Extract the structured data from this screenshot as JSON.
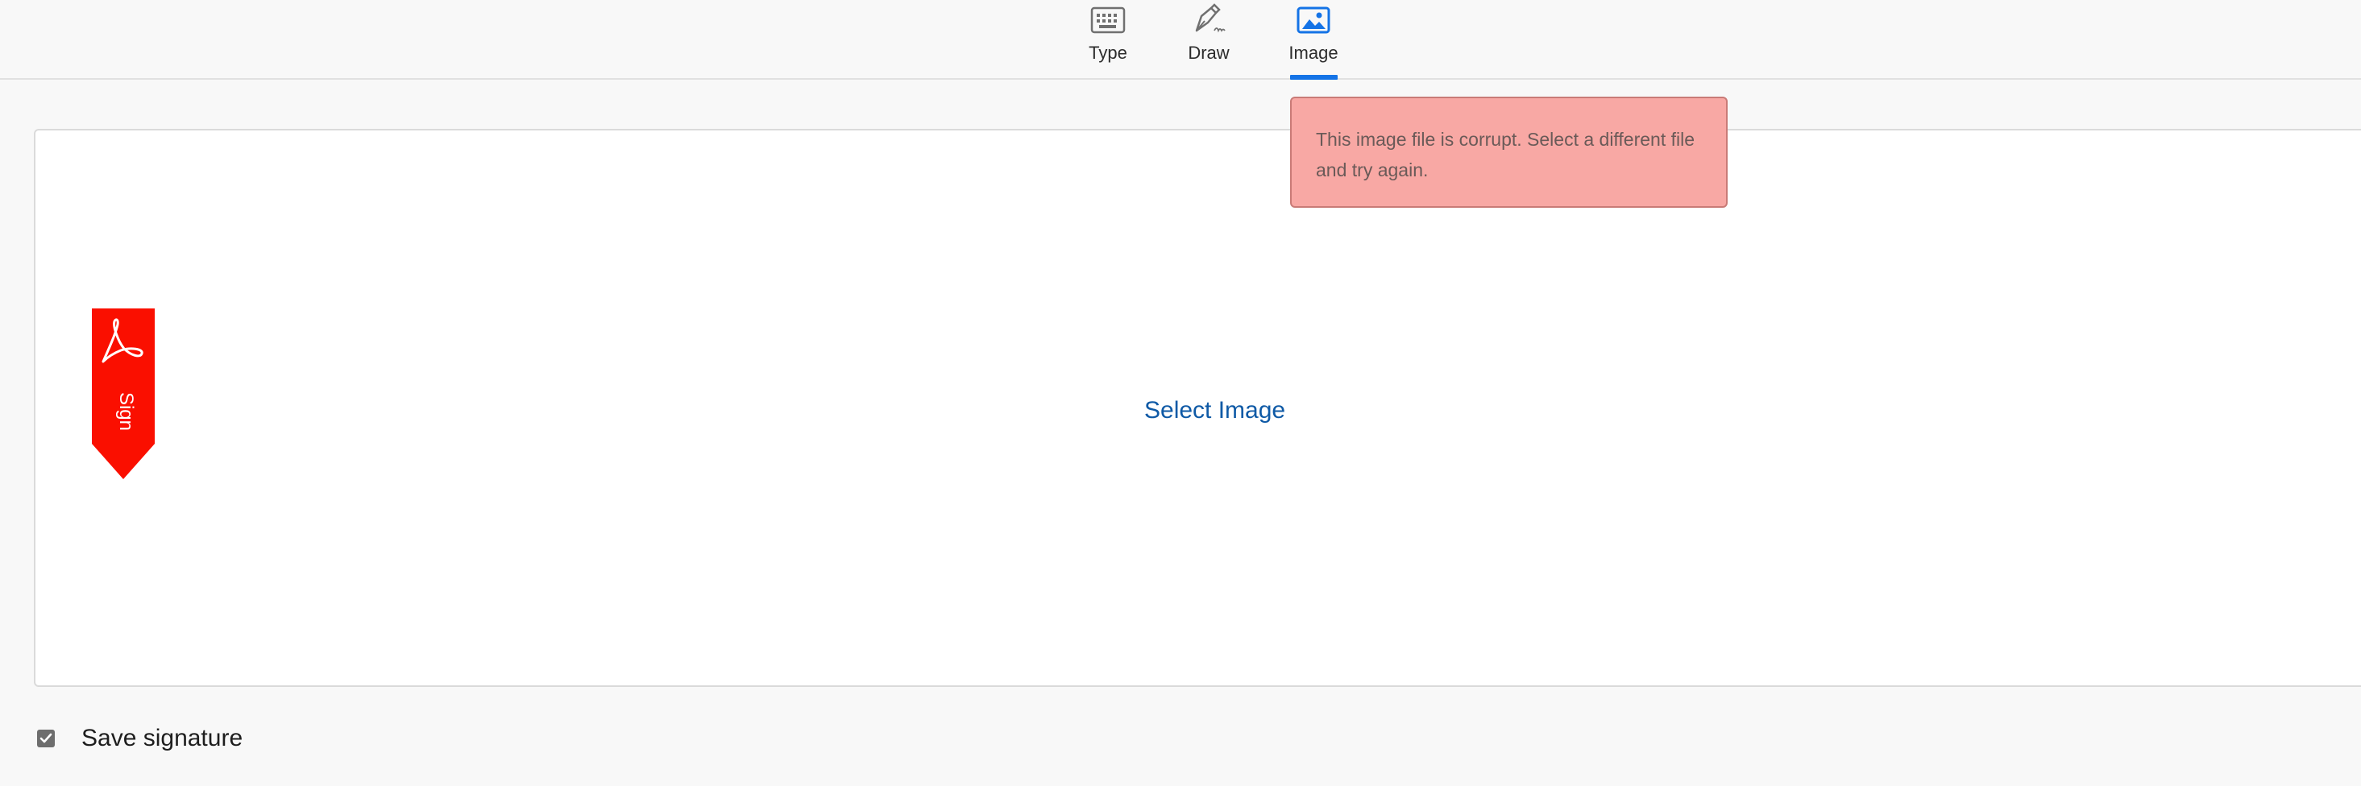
{
  "tabs": {
    "type_label": "Type",
    "draw_label": "Draw",
    "image_label": "Image",
    "active": "Image"
  },
  "canvas": {
    "select_image_label": "Select Image"
  },
  "badge": {
    "text": "Sign",
    "color": "#fa0f00"
  },
  "tooltip": {
    "message": "This image file is corrupt. Select a different file and try again."
  },
  "save_signature": {
    "label": "Save signature",
    "checked": true
  },
  "colors": {
    "accent": "#1473e6",
    "link": "#0f5aa6",
    "error_bg": "#f8a8a4"
  }
}
